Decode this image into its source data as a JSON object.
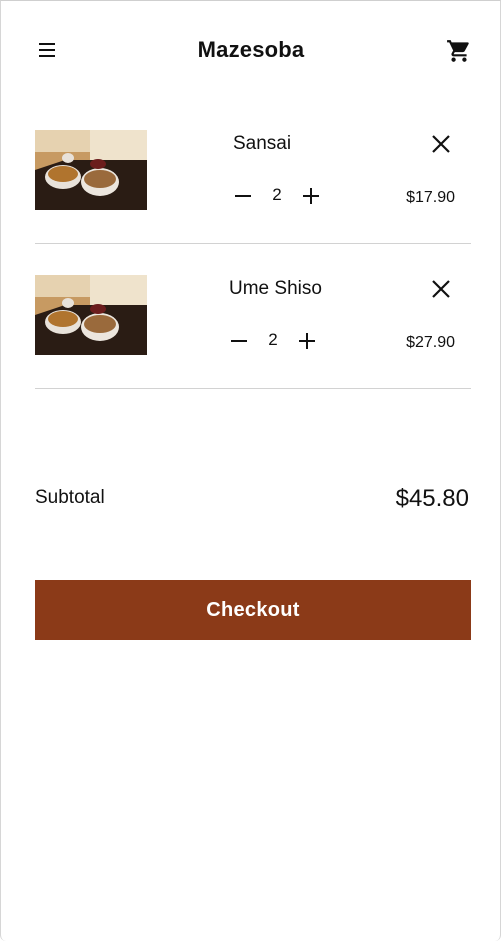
{
  "app": {
    "title": "Mazesoba"
  },
  "icons": {
    "menu": "menu-icon",
    "cart": "shopping-cart-icon",
    "remove": "close-icon",
    "minus": "minus-icon",
    "plus": "plus-icon"
  },
  "cart": {
    "items": [
      {
        "name": "Sansai",
        "quantity": "2",
        "price": "$17.90"
      },
      {
        "name": "Ume Shiso",
        "quantity": "2",
        "price": "$27.90"
      }
    ]
  },
  "summary": {
    "subtotal_label": "Subtotal",
    "subtotal_value": "$45.80"
  },
  "actions": {
    "checkout_label": "Checkout"
  },
  "colors": {
    "checkout_button": "#8b3a18",
    "divider": "#d2d2d2"
  }
}
